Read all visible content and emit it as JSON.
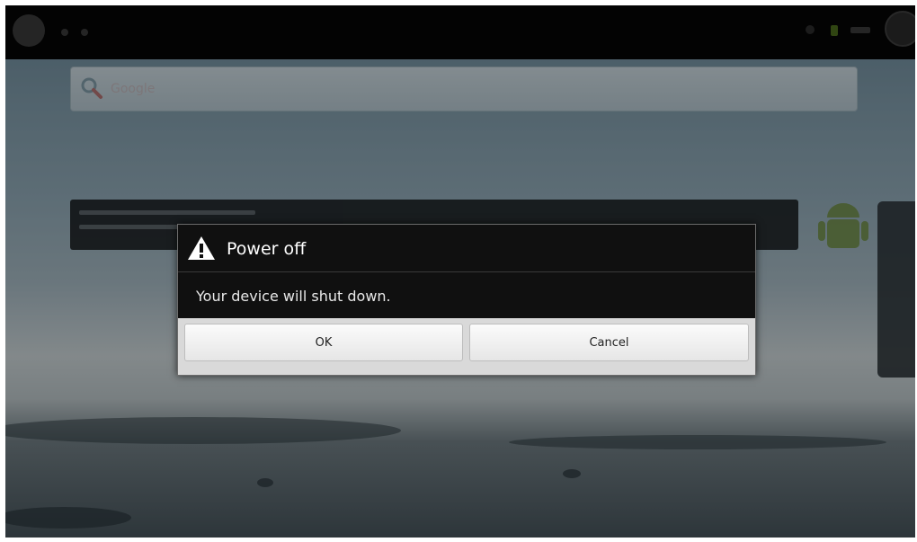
{
  "status_bar": {
    "icons": [
      "android-logo-icon",
      "notification-icon",
      "wifi-icon",
      "battery-icon",
      "clock",
      "profile-icon"
    ]
  },
  "home": {
    "search_placeholder": "Google",
    "tip_line_1": "Drag apps to your Home screen.",
    "tip_line_2": "Touch & hold an app."
  },
  "dialog": {
    "icon": "warning-icon",
    "title": "Power off",
    "message": "Your device will shut down.",
    "ok_label": "OK",
    "cancel_label": "Cancel"
  },
  "colors": {
    "dialog_bg": "#101010",
    "button_bar_bg": "#d9d9d9",
    "status_bar_bg": "#050505"
  }
}
